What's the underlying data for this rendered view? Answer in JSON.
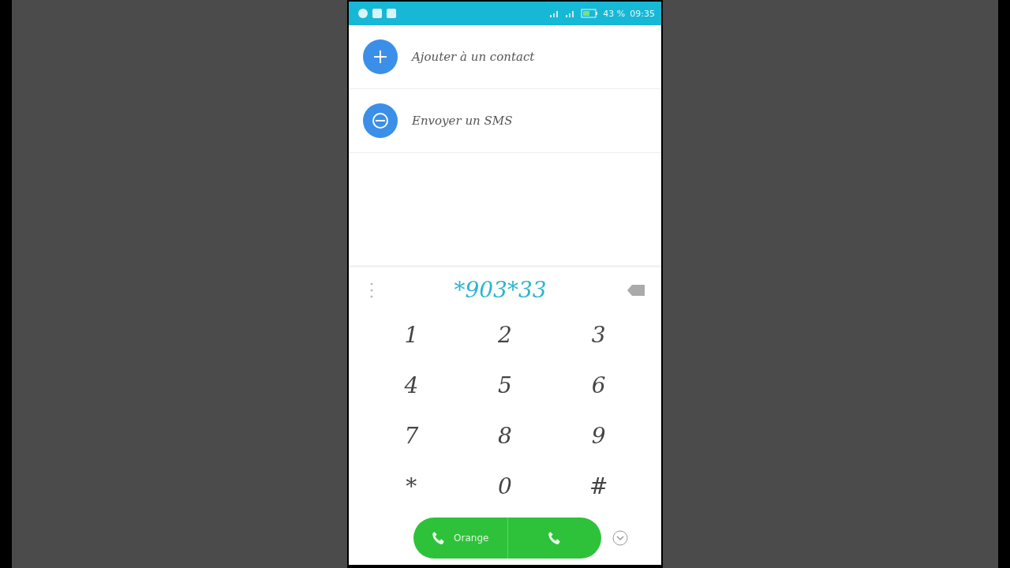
{
  "status_bar": {
    "battery": "43 %",
    "time": "09:35"
  },
  "actions": [
    {
      "kind": "add",
      "label": "Ajouter à un contact"
    },
    {
      "kind": "sms",
      "label": "Envoyer un SMS"
    }
  ],
  "dialer": {
    "number": "*903*33"
  },
  "keys": [
    "1",
    "2",
    "3",
    "4",
    "5",
    "6",
    "7",
    "8",
    "9",
    "*",
    "0",
    "#"
  ],
  "call_bar": {
    "first_label": "Orange"
  }
}
